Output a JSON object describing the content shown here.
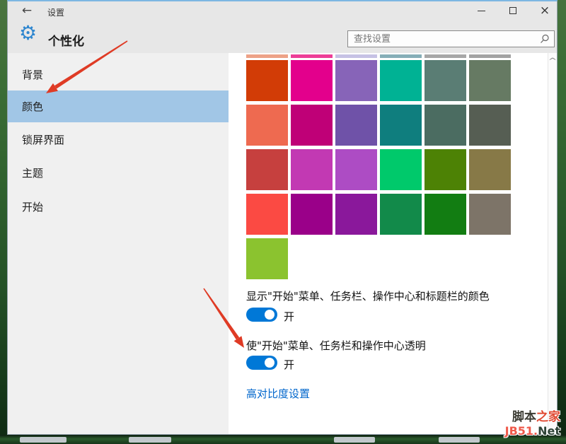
{
  "window": {
    "title": "设置",
    "controls": {
      "minimize": "minimize",
      "maximize": "maximize",
      "close": "×"
    }
  },
  "header": {
    "title": "个性化"
  },
  "search": {
    "placeholder": "查找设置"
  },
  "sidebar": {
    "items": [
      {
        "label": "背景",
        "selected": false
      },
      {
        "label": "颜色",
        "selected": true
      },
      {
        "label": "锁屏界面",
        "selected": false
      },
      {
        "label": "主题",
        "selected": false
      },
      {
        "label": "开始",
        "selected": false
      }
    ]
  },
  "swatches": {
    "top_strips": [
      "#eda287",
      "#ed3e97",
      "#c6c2e4",
      "#86aeb8",
      "#a7a7a7",
      "#a3a3a3"
    ],
    "rows": [
      [
        "#d23c06",
        "#e3008c",
        "#8764b8",
        "#00b294",
        "#5a7d74",
        "#667a63"
      ],
      [
        "#ee6a50",
        "#bf0077",
        "#6f52a8",
        "#0f7e7e",
        "#4b6c61",
        "#565e53"
      ],
      [
        "#c6403e",
        "#c239b3",
        "#ad4cc4",
        "#00c96b",
        "#4d8205",
        "#877947"
      ],
      [
        "#fb4a43",
        "#9a0089",
        "#8a189b",
        "#128a4a",
        "#127d12",
        "#7d7468"
      ],
      [
        "#8bc32f"
      ]
    ]
  },
  "settings": [
    {
      "label": "显示\"开始\"菜单、任务栏、操作中心和标题栏的颜色",
      "state": "开",
      "on": true
    },
    {
      "label": "使\"开始\"菜单、任务栏和操作中心透明",
      "state": "开",
      "on": true
    }
  ],
  "links": {
    "high_contrast": "高对比度设置"
  },
  "watermark": {
    "part1": "脚本",
    "part2": "之家",
    "line2a": "JB51.",
    "line2b": "Net"
  },
  "colors": {
    "chrome_bg": "#e7e7e7",
    "sidebar_bg": "#f0f0f0",
    "selected_item_bg": "#a1c6e6",
    "toggle_on": "#0078d7",
    "link": "#0066cc",
    "annotation_arrow": "#df3b25"
  }
}
